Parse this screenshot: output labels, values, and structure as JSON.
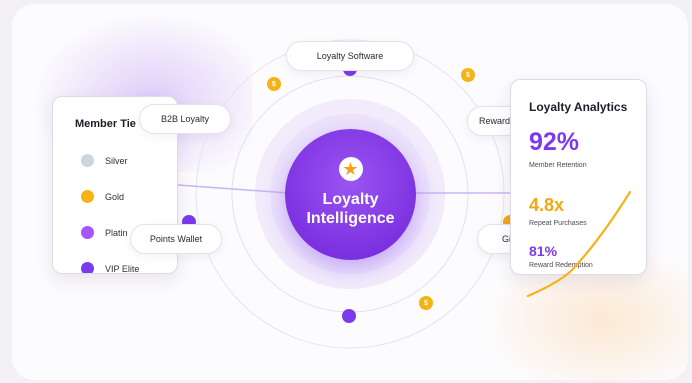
{
  "hub": {
    "title": "Loyalty Intelligence",
    "star_icon": "star-icon"
  },
  "pills": {
    "loyalty_software": "Loyalty Software",
    "b2b_loyalty": "B2B Loyalty",
    "points_wallet": "Points Wallet",
    "reward": "Reward",
    "gift": "Gi"
  },
  "member_tiers": {
    "title": "Member Tie",
    "items": [
      {
        "label": "Silver",
        "color": "#cdd5e0"
      },
      {
        "label": "Gold",
        "color": "#f5b316"
      },
      {
        "label": "Platin",
        "color": "#a855f7"
      },
      {
        "label": "VIP Elite",
        "color": "#7c3aed"
      }
    ]
  },
  "analytics": {
    "title": "Loyalty Analytics",
    "metrics": [
      {
        "value": "92%",
        "label": "Member Retention",
        "color": "#7c3aed"
      },
      {
        "value": "4.8x",
        "label": "Repeat Purchases",
        "color": "#f5a615"
      },
      {
        "value": "81%",
        "label": "Reward Redemption",
        "color": "#7c3aed"
      }
    ]
  },
  "coin_symbol": "$",
  "colors": {
    "accent_purple": "#7c3aed",
    "accent_orange": "#f5b316"
  }
}
